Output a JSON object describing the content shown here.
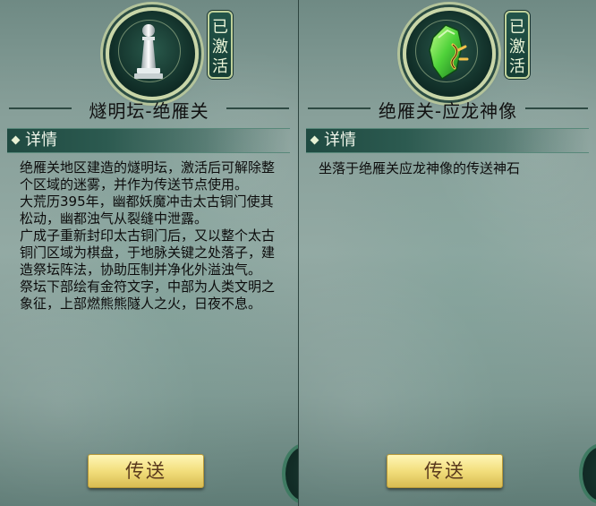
{
  "panels": [
    {
      "emblem_icon": "chess-pawn-icon",
      "tag_chars": [
        "已",
        "激",
        "活"
      ],
      "title": "燧明坛-绝雁关",
      "details_label": "详情",
      "description": [
        "绝雁关地区建造的燧明坛，激活后可解除整个区域的迷雾，并作为传送节点使用。",
        "大荒历395年，幽都妖魔冲击太古铜门使其松动，幽都浊气从裂缝中泄露。",
        "广成子重新封印太古铜门后，又以整个太古铜门区域为棋盘，于地脉关键之处落子，建造祭坛阵法，协助压制并净化外溢浊气。",
        "祭坛下部绘有金符文字，中部为人类文明之象征，上部燃熊熊隧人之火，日夜不息。"
      ],
      "button_label": "传送"
    },
    {
      "emblem_icon": "jade-stone-icon",
      "tag_chars": [
        "已",
        "激",
        "活"
      ],
      "title": "绝雁关-应龙神像",
      "details_label": "详情",
      "description": [
        "坐落于绝雁关应龙神像的传送神石"
      ],
      "button_label": "传送"
    }
  ],
  "colors": {
    "button_fill": "#f2de7c",
    "button_text": "#5a3a1e",
    "details_bar": "#2c5a50",
    "tag_fill": "#23554a",
    "panel_bg": "#879f99"
  }
}
